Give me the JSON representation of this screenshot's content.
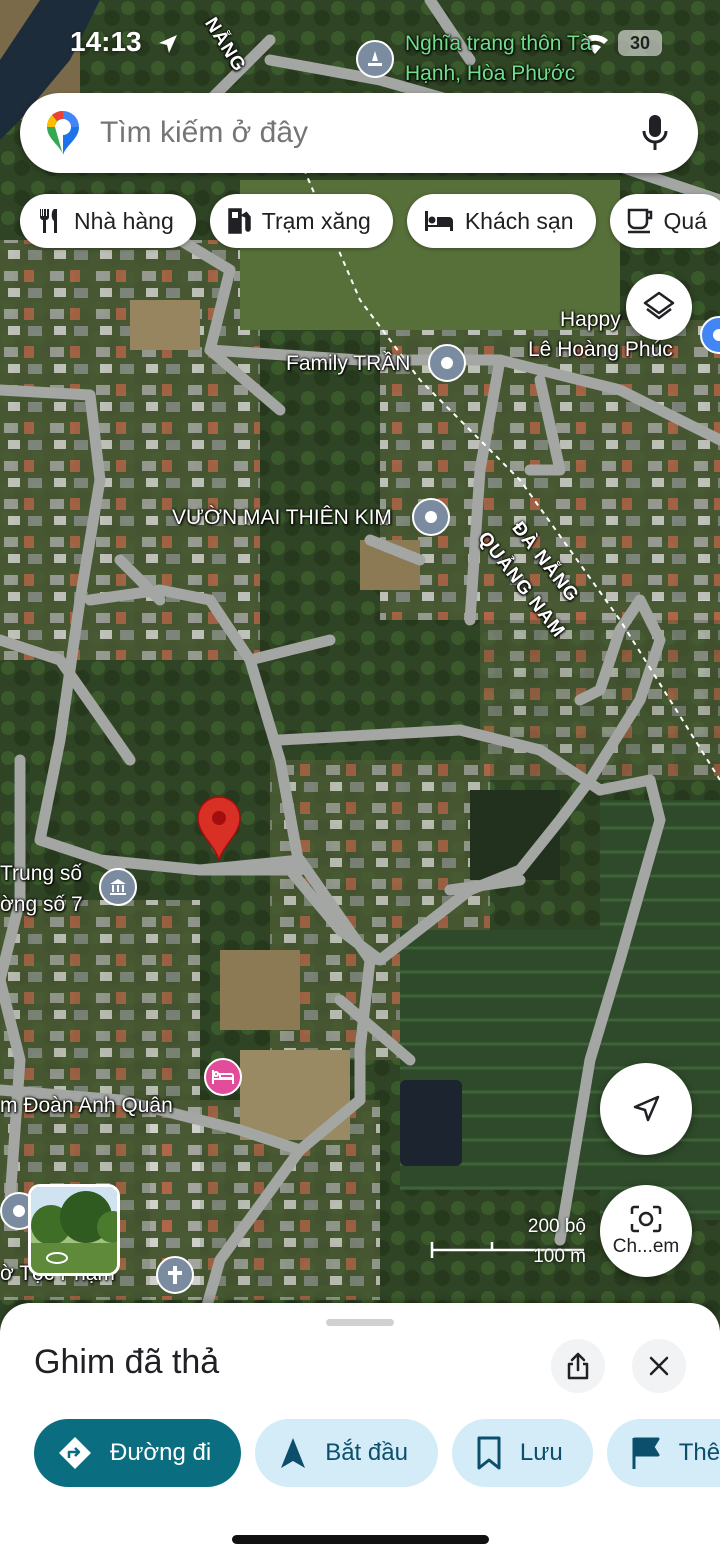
{
  "status_bar": {
    "time": "14:13",
    "signal_badge": "30"
  },
  "search": {
    "placeholder": "Tìm kiếm ở đây"
  },
  "chips": [
    {
      "label": "Nhà hàng",
      "icon": "restaurant-icon"
    },
    {
      "label": "Trạm xăng",
      "icon": "gas-station-icon"
    },
    {
      "label": "Khách sạn",
      "icon": "hotel-icon"
    },
    {
      "label": "Quá",
      "icon": "cafe-icon"
    }
  ],
  "map_labels": {
    "cemetery_line1": "Nghĩa trang thôn Tà",
    "cemetery_line2": "Hạnh, Hòa Phước",
    "road_top": "NẴNG",
    "happy": "Happy",
    "le_hoang_phuc": "Lê Hoàng Phúc",
    "family_tran": "Family TRẦN",
    "vuon_mai": "VƯỜN MAI THIÊN KIM",
    "road_da_nang": "ĐÀ NẴNG",
    "road_quang_nam": "QUẢNG NAM",
    "trung_so_line1": "Trung số",
    "trung_so_line2": "ờng số 7",
    "hotel": "m Đoàn Anh Quân",
    "bottom_left": "ờ Tộc Phạm"
  },
  "scale": {
    "imperial": "200 bộ",
    "metric": "100 m"
  },
  "camera_button_label": "Ch...em",
  "sheet": {
    "title": "Ghim đã thả",
    "actions": [
      {
        "label": "Đường đi",
        "icon": "directions-icon"
      },
      {
        "label": "Bắt đầu",
        "icon": "navigation-icon"
      },
      {
        "label": "Lưu",
        "icon": "bookmark-icon"
      },
      {
        "label": "Thê",
        "icon": "flag-icon"
      }
    ]
  },
  "colors": {
    "accent": "#0b6e80",
    "pin": "#d93025",
    "chip_bg": "#d3ecf7"
  }
}
